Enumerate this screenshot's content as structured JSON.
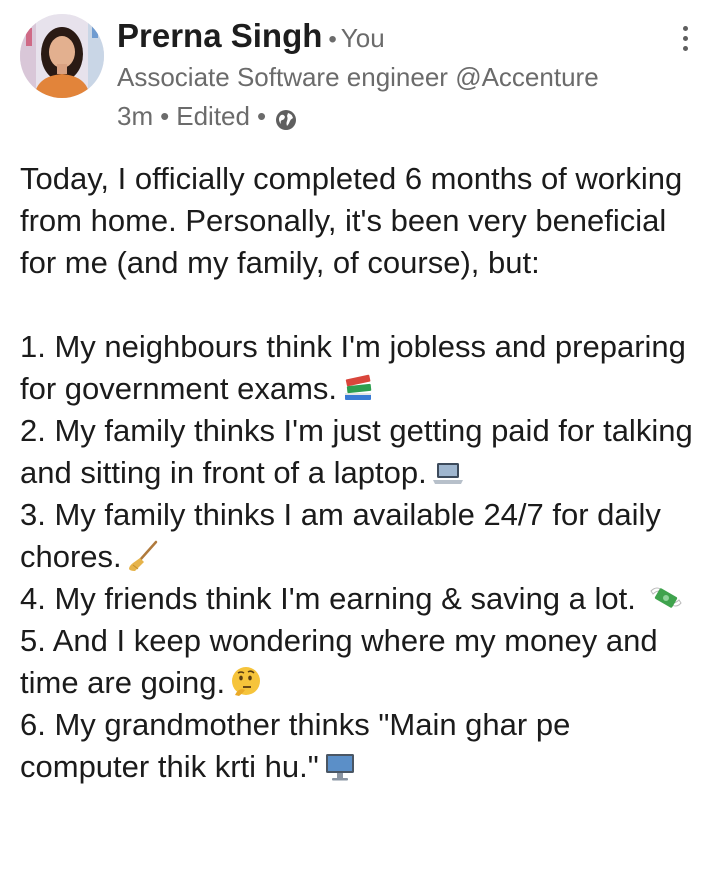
{
  "post": {
    "author": {
      "name": "Prerna Singh",
      "separator": "•",
      "relation": "You",
      "headline": "Associate Software engineer @Accenture"
    },
    "meta": {
      "time": "3m",
      "edited": "Edited",
      "visibility_icon": "globe-icon"
    },
    "more_icon": "more-vertical-icon",
    "body": {
      "intro_lines": [
        "Today, I officially completed 6 months of working from home. Personally, it's been very beneficial for me (and my family, of course), but:"
      ],
      "items": [
        {
          "text": "1. My neighbours think I'm jobless and preparing for government exams.",
          "emoji": "books-emoji"
        },
        {
          "text": "2. My family thinks I'm just getting paid for talking and sitting in front of a laptop.",
          "emoji": "laptop-emoji"
        },
        {
          "text": "3. My family thinks I am available 24/7 for daily chores.",
          "emoji": "broom-emoji"
        },
        {
          "text": "4. My friends think I'm earning & saving a lot.",
          "emoji": "money-with-wings-emoji"
        },
        {
          "text": "5. And I keep wondering where my money and time are going.",
          "emoji": "thinking-face-emoji"
        },
        {
          "text": "6. My grandmother thinks \"Main ghar pe computer thik krti hu.\"",
          "emoji": "desktop-computer-emoji"
        }
      ]
    }
  },
  "colors": {
    "name": "#1d1d1d",
    "muted": "#6b6b6b",
    "body": "#1b1b1b"
  }
}
